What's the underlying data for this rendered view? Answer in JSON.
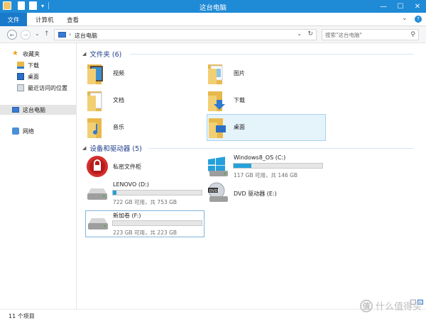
{
  "window": {
    "title": "这台电脑",
    "minimize": "—",
    "maximize": "☐",
    "close": "✕"
  },
  "ribbon": {
    "file_tab": "文件",
    "tabs": [
      "计算机",
      "查看"
    ],
    "expand_glyph": "⌄",
    "help_glyph": "?"
  },
  "address": {
    "path": "这台电脑",
    "refresh_glyph": "↻",
    "dropdown_glyph": "⌄"
  },
  "search": {
    "placeholder": "搜索\"这台电脑\""
  },
  "sidebar": {
    "favorites": "收藏夹",
    "fav_items": [
      "下载",
      "桌面",
      "最近访问的位置"
    ],
    "this_pc": "这台电脑",
    "network": "网络"
  },
  "groups": {
    "folders": {
      "title": "文件夹 (6)"
    },
    "devices": {
      "title": "设备和驱动器 (5)"
    }
  },
  "folders": [
    {
      "name": "视频"
    },
    {
      "name": "图片"
    },
    {
      "name": "文档"
    },
    {
      "name": "下载"
    },
    {
      "name": "音乐"
    },
    {
      "name": "桌面"
    }
  ],
  "devices": [
    {
      "name": "私密文件柜",
      "type": "vault"
    },
    {
      "name": "Windows8_OS (C:)",
      "type": "drive",
      "usage": 0.2,
      "space": "117 GB 可用，共 146 GB"
    },
    {
      "name": "LENOVO (D:)",
      "type": "drive",
      "usage": 0.04,
      "space": "722 GB 可用，共 753 GB"
    },
    {
      "name": "DVD 驱动器 (E:)",
      "type": "dvd"
    },
    {
      "name": "新加卷 (F:)",
      "type": "drive",
      "usage": 0.0,
      "space": "223 GB 可用，共 223 GB"
    }
  ],
  "status": {
    "count": "11 个项目"
  },
  "watermark": {
    "text": "什么值得买",
    "badge": "值"
  },
  "colors": {
    "title_bar": "#1f8ad6",
    "file_tab": "#1979ca",
    "folder": "#e8b84a",
    "progress": "#26a0da",
    "group_title": "#1e3a8a"
  }
}
